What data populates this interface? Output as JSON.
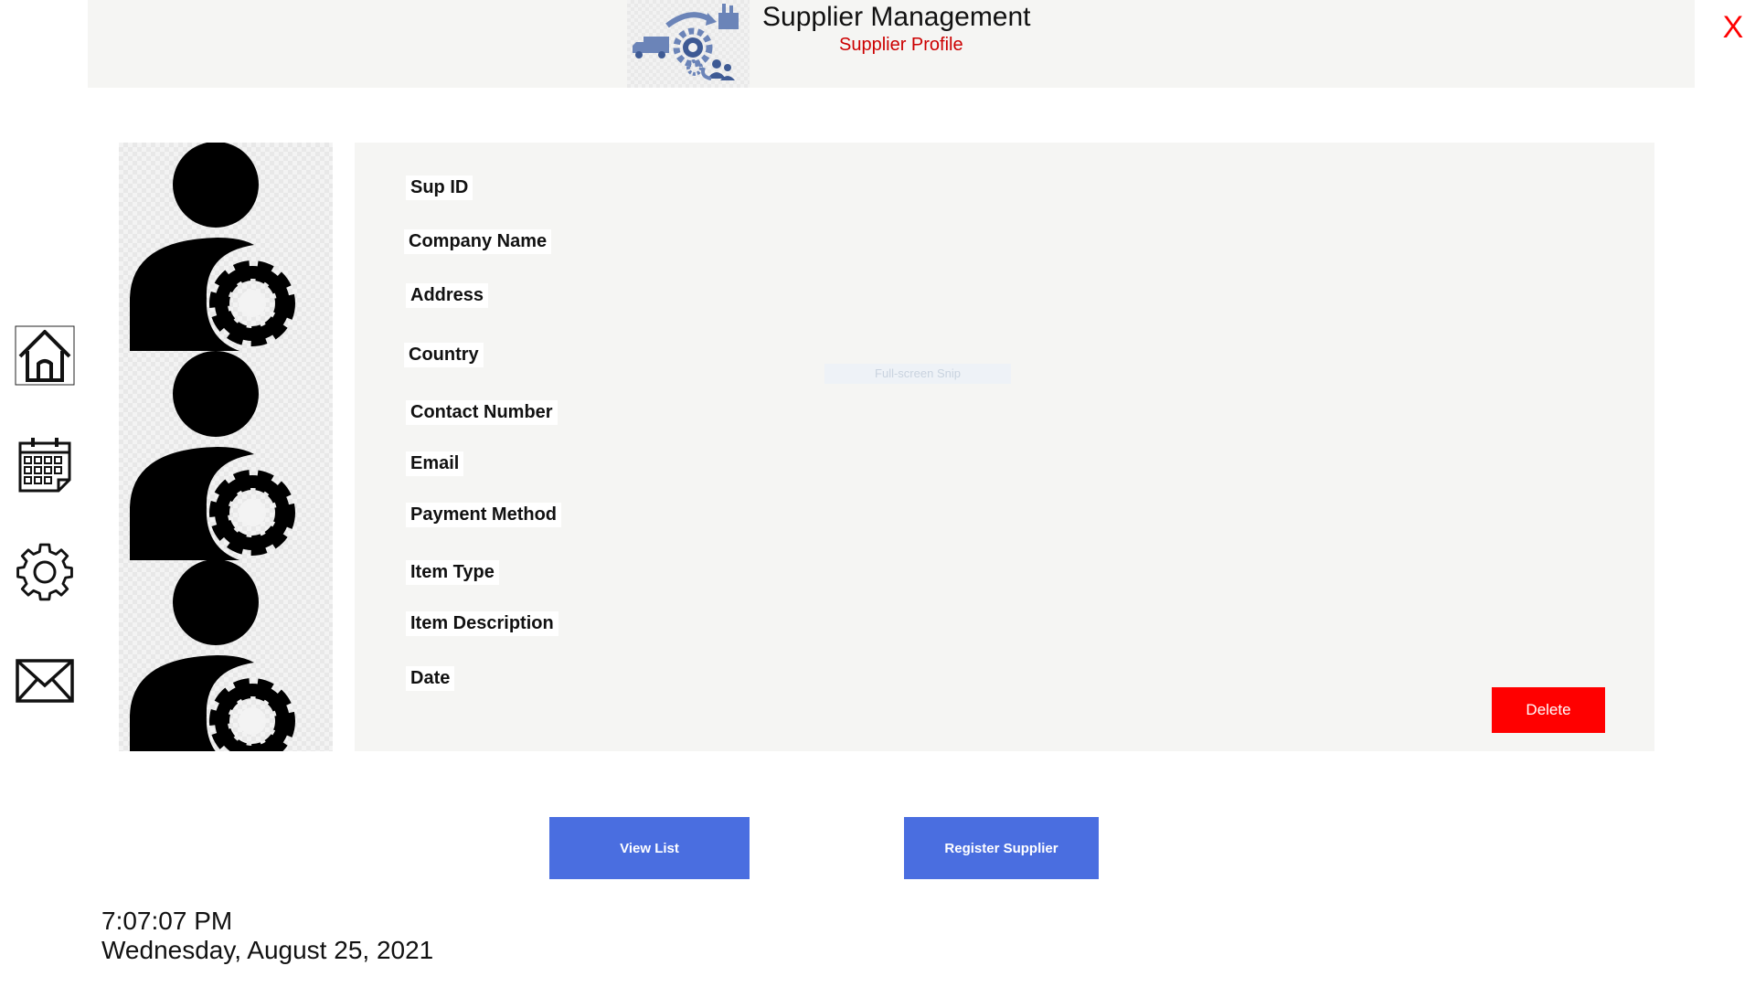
{
  "header": {
    "title": "Supplier Management",
    "subtitle": "Supplier Profile",
    "close_label": "X",
    "logo_icon": "supplier-logistics-logo-icon"
  },
  "sidebar": {
    "items": [
      {
        "name": "home",
        "icon": "home-icon"
      },
      {
        "name": "calendar",
        "icon": "calendar-icon"
      },
      {
        "name": "settings",
        "icon": "gear-icon"
      },
      {
        "name": "mail",
        "icon": "mail-icon"
      }
    ]
  },
  "illustration": {
    "icon": "user-settings-icon",
    "repeat": 3
  },
  "profile": {
    "fields": [
      {
        "label": "Sup ID",
        "value": ""
      },
      {
        "label": "Company Name",
        "value": ""
      },
      {
        "label": "Address",
        "value": ""
      },
      {
        "label": "Country",
        "value": ""
      },
      {
        "label": "Contact Number",
        "value": ""
      },
      {
        "label": "Email",
        "value": ""
      },
      {
        "label": "Payment Method",
        "value": ""
      },
      {
        "label": "Item Type",
        "value": ""
      },
      {
        "label": "Item Description",
        "value": ""
      },
      {
        "label": "Date",
        "value": ""
      }
    ],
    "snip_hint": "Full-screen Snip",
    "delete_label": "Delete"
  },
  "actions": {
    "view_list_label": "View List",
    "register_label": "Register Supplier"
  },
  "clock": {
    "time": "7:07:07 PM",
    "date": "Wednesday, August 25, 2021"
  },
  "colors": {
    "accent_blue": "#4a6ee0",
    "danger_red": "#ff0000",
    "subtitle_red": "#cc0000",
    "panel_bg": "#f5f5f3"
  }
}
